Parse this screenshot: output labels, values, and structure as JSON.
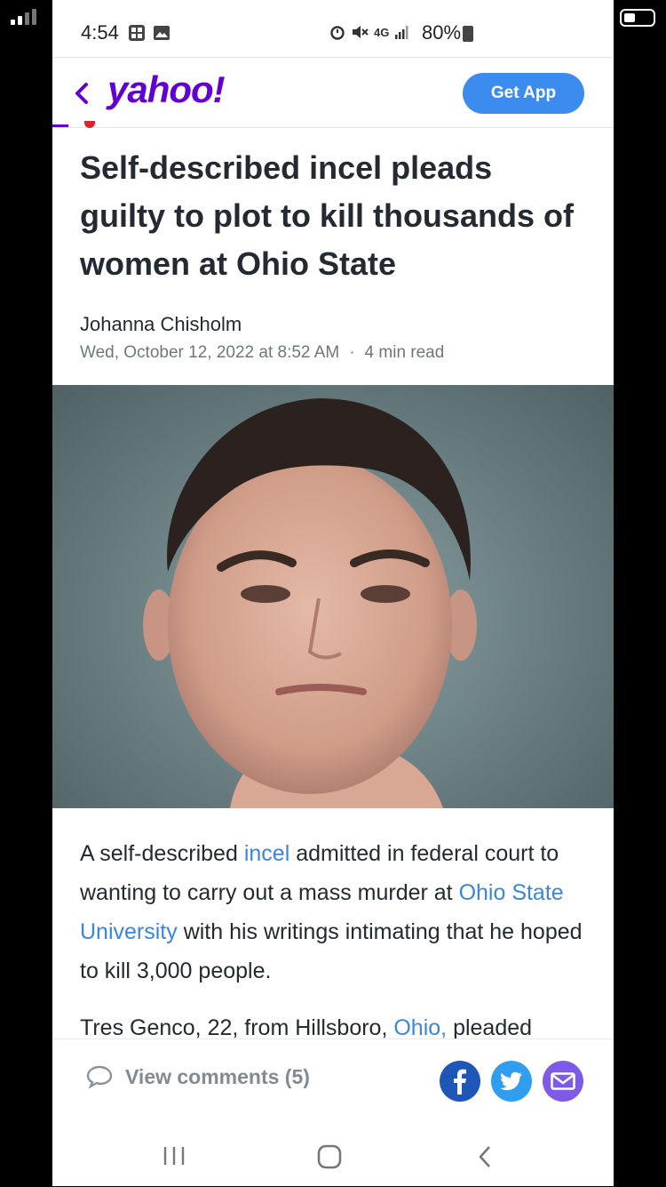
{
  "status_bar": {
    "time": "4:54",
    "battery": "80%",
    "network": "4G"
  },
  "header": {
    "logo": "yahoo!",
    "get_app_label": "Get App"
  },
  "article": {
    "headline": "Self-described incel pleads guilty to plot to kill thousands of women at Ohio State",
    "author": "Johanna Chisholm",
    "date": "Wed, October 12, 2022 at 8:52 AM",
    "separator": "·",
    "read_time": "4 min read",
    "p1": {
      "t1": "A self-described ",
      "link1": "incel",
      "t2": " admitted in federal court to wanting to carry out a mass murder at ",
      "link2": "Ohio State University",
      "t3": " with his writings intimating that he hoped to kill 3,000 people."
    },
    "p2": {
      "t1": "Tres Genco, 22, from Hillsboro, ",
      "link1": "Ohio,",
      "t2": " pleaded"
    }
  },
  "footer": {
    "comments_label": "View comments (5)"
  },
  "colors": {
    "brand": "#6001d2",
    "button": "#3c8cf0",
    "link": "#3b86d8",
    "facebook": "#1f57b8",
    "twitter": "#2f9ef0",
    "mail": "#7d5be6"
  },
  "icons": [
    "back-chevron-icon",
    "comment-bubble-icon",
    "facebook-icon",
    "twitter-icon",
    "mail-icon",
    "recent-apps-icon",
    "home-icon",
    "back-nav-icon"
  ]
}
